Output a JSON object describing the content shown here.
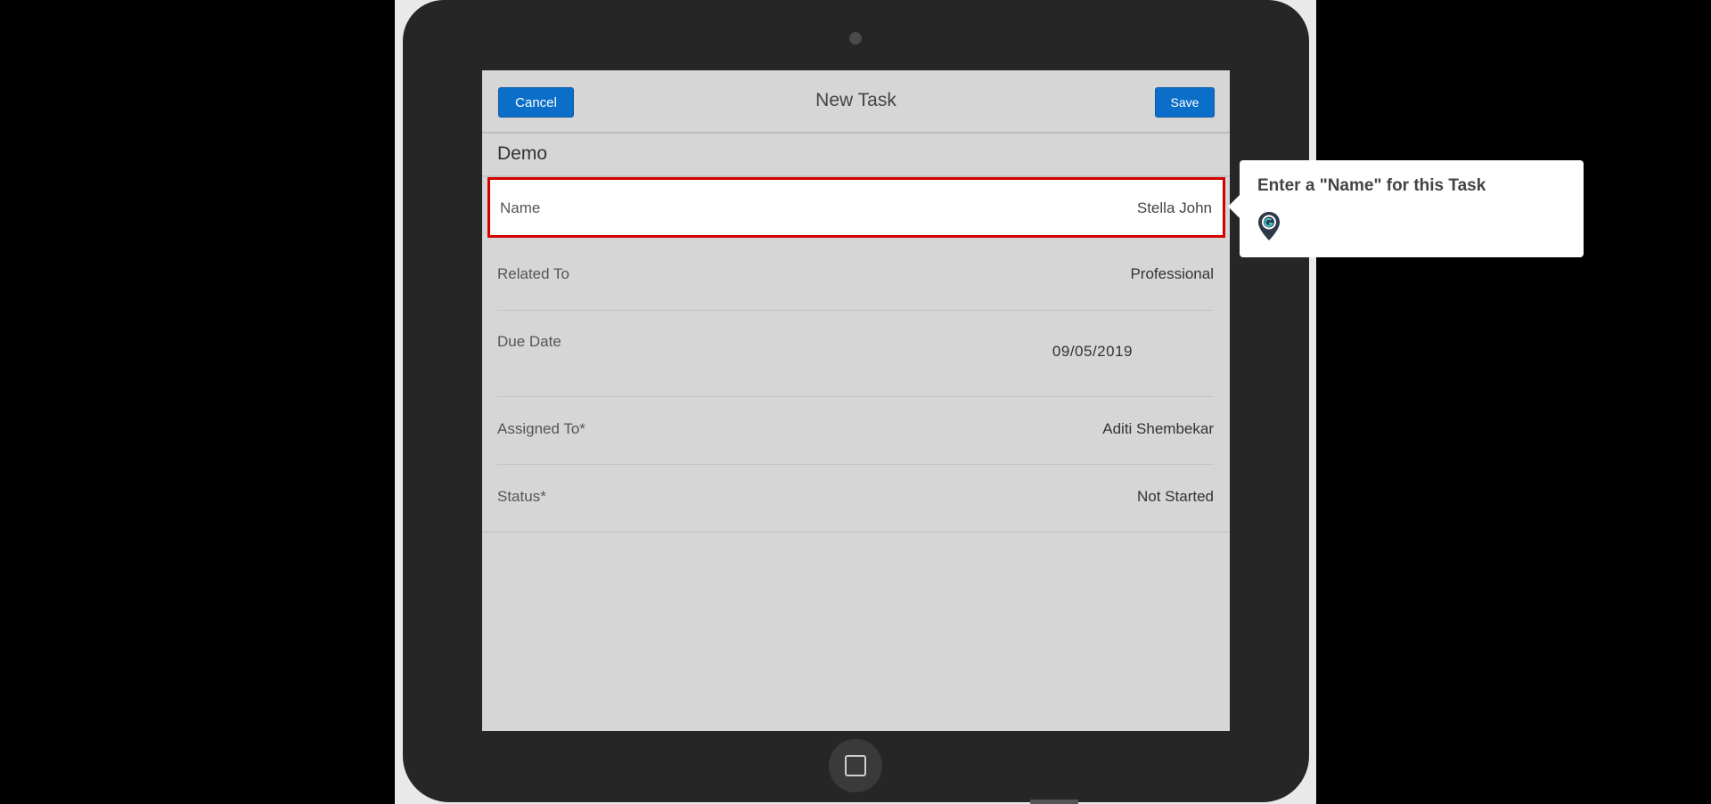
{
  "header": {
    "title": "New Task",
    "cancel_label": "Cancel",
    "save_label": "Save"
  },
  "section": {
    "title": "Demo"
  },
  "fields": {
    "name": {
      "label": "Name",
      "value": "Stella John"
    },
    "related_to": {
      "label": "Related To",
      "value": "Professional"
    },
    "due_date": {
      "label": "Due Date",
      "value": "09/05/2019"
    },
    "assigned_to": {
      "label": "Assigned To*",
      "value": "Aditi Shembekar"
    },
    "status": {
      "label": "Status*",
      "value": "Not Started"
    }
  },
  "tooltip": {
    "text": "Enter a \"Name\" for this Task",
    "icon": "guide-pin-icon"
  },
  "colors": {
    "primary_button": "#0b6fc9",
    "highlight_border": "#d40000",
    "device_body": "#262626",
    "screen_bg": "#d6d6d6"
  }
}
